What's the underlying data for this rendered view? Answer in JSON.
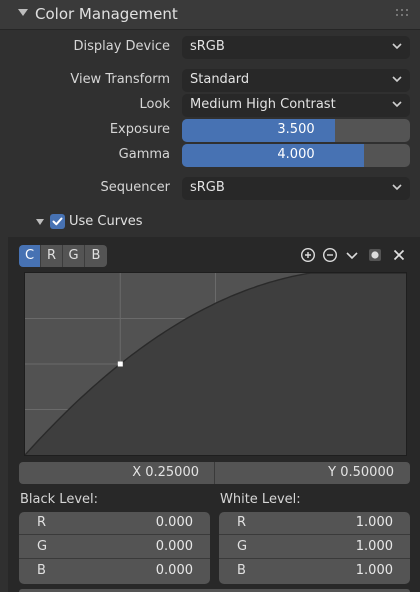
{
  "panel": {
    "title": "Color Management"
  },
  "display_device": {
    "label": "Display Device",
    "value": "sRGB"
  },
  "view_transform": {
    "label": "View Transform",
    "value": "Standard"
  },
  "look": {
    "label": "Look",
    "value": "Medium High Contrast"
  },
  "exposure": {
    "label": "Exposure",
    "value": "3.500",
    "fill_fraction": 0.67
  },
  "gamma": {
    "label": "Gamma",
    "value": "4.000",
    "fill_fraction": 0.8
  },
  "sequencer": {
    "label": "Sequencer",
    "value": "sRGB"
  },
  "use_curves": {
    "label": "Use Curves",
    "checked": true
  },
  "channels": [
    "C",
    "R",
    "G",
    "B"
  ],
  "active_channel": "C",
  "curve": {
    "selected_point": {
      "x": 0.25,
      "y": 0.5
    },
    "x_readout": "X 0.25000",
    "y_readout": "Y 0.50000"
  },
  "black_level": {
    "title": "Black Level:",
    "rows": [
      {
        "channel": "R",
        "value": "0.000"
      },
      {
        "channel": "G",
        "value": "0.000"
      },
      {
        "channel": "B",
        "value": "0.000"
      }
    ]
  },
  "white_level": {
    "title": "White Level:",
    "rows": [
      {
        "channel": "R",
        "value": "1.000"
      },
      {
        "channel": "G",
        "value": "1.000"
      },
      {
        "channel": "B",
        "value": "1.000"
      }
    ]
  },
  "icons": [
    "panel-collapse-icon",
    "drag-grip-icon",
    "chevron-down-icon",
    "checkmark-icon",
    "zoom-in-icon",
    "zoom-out-icon",
    "tools-menu-icon",
    "handle-type-icon",
    "reset-x-icon"
  ],
  "colors": {
    "accent": "#4772b3",
    "panel_bg": "#303030",
    "field_bg": "#545454",
    "dropdown_bg": "#282828",
    "graph_bg": "#525252"
  }
}
